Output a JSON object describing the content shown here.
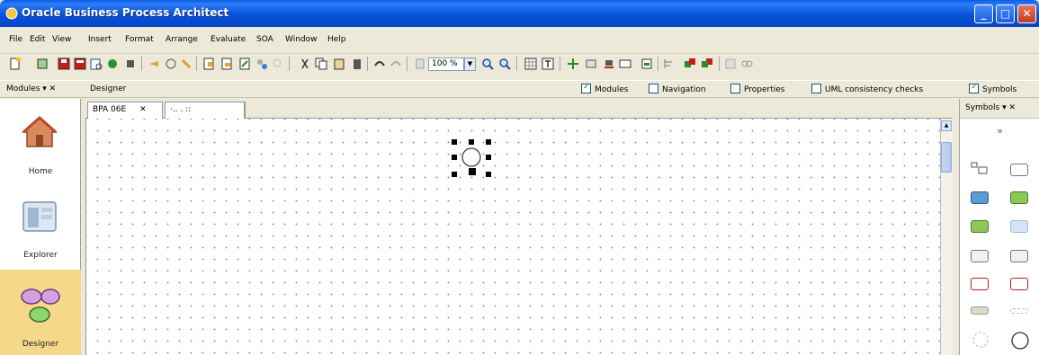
{
  "window": {
    "title": "Oracle Business Process Architect",
    "controls": [
      "_",
      "□",
      "✕"
    ]
  },
  "menu": [
    "File",
    "Edit",
    "View",
    "Insert",
    "Format",
    "Arrange",
    "Evaluate",
    "SOA",
    "Window",
    "Help"
  ],
  "toolbar": {
    "zoom_value": "100 %"
  },
  "modules_pane": {
    "title": "Modules",
    "items": [
      {
        "label": "Home",
        "icon": "house-icon"
      },
      {
        "label": "Explorer",
        "icon": "explorer-icon"
      },
      {
        "label": "Designer",
        "icon": "designer-icon",
        "active": true
      }
    ]
  },
  "designer": {
    "title": "Designer",
    "tabs": [
      {
        "label": "BPA 06E",
        "close": "✕"
      },
      {
        "label": "",
        "dots": "·.. . ::"
      }
    ]
  },
  "view_options": [
    {
      "label": "Modules",
      "checked": true
    },
    {
      "label": "Navigation",
      "checked": false
    },
    {
      "label": "Properties",
      "checked": false
    },
    {
      "label": "UML consistency checks",
      "checked": false
    },
    {
      "label": "Symbols",
      "checked": true
    }
  ],
  "symbols_pane": {
    "title": "Symbols",
    "more": "»"
  },
  "colors": {
    "titlebar": "#0652d9",
    "active_module": "#f5d889",
    "canvas_dot": "#8aa0c0"
  }
}
